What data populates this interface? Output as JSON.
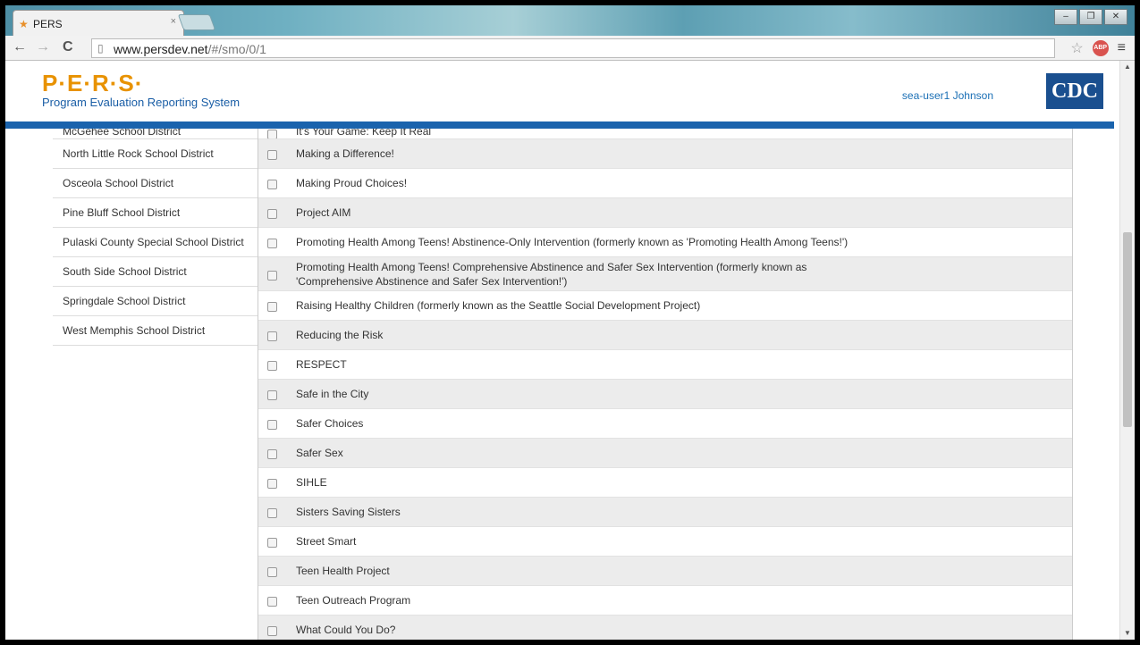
{
  "browser": {
    "tab_title": "PERS",
    "tab_close": "×",
    "url_host": "www.persdev.net",
    "url_path": "/#/smo/0/1",
    "buttons": {
      "minimize": "–",
      "restore": "❐",
      "close": "✕",
      "back": "←",
      "forward": "→",
      "reload": "C",
      "star": "☆",
      "abp": "ABP",
      "menu": "≡"
    }
  },
  "header": {
    "logo_mark": "P·E·R·S·",
    "logo_subtitle": "Program Evaluation Reporting System",
    "user": "sea-user1 Johnson",
    "agency_logo": "CDC"
  },
  "districts": [
    "McGehee School District",
    "North Little Rock School District",
    "Osceola School District",
    "Pine Bluff School District",
    "Pulaski County Special School District",
    "South Side School District",
    "Springdale School District",
    "West Memphis School District"
  ],
  "programs": [
    "It's Your Game: Keep It Real",
    "Making a Difference!",
    "Making Proud Choices!",
    "Project AIM",
    "Promoting Health Among Teens! Abstinence-Only Intervention (formerly known as 'Promoting Health Among Teens!')",
    "Promoting Health Among Teens! Comprehensive Abstinence and Safer Sex Intervention (formerly known as 'Comprehensive Abstinence and Safer Sex Intervention!')",
    "Raising Healthy Children (formerly known as the Seattle Social Development Project)",
    "Reducing the Risk",
    "RESPECT",
    "Safe in the City",
    "Safer Choices",
    "Safer Sex",
    "SIHLE",
    "Sisters Saving Sisters",
    "Street Smart",
    "Teen Health Project",
    "Teen Outreach Program",
    "What Could You Do?"
  ],
  "icons": {
    "favicon": "star-icon",
    "page": "page-icon",
    "scroll_up": "▲",
    "scroll_down": "▼"
  },
  "colors": {
    "brand_orange": "#e89200",
    "brand_blue": "#1a63ad",
    "cdc_blue": "#1a4f8f"
  }
}
